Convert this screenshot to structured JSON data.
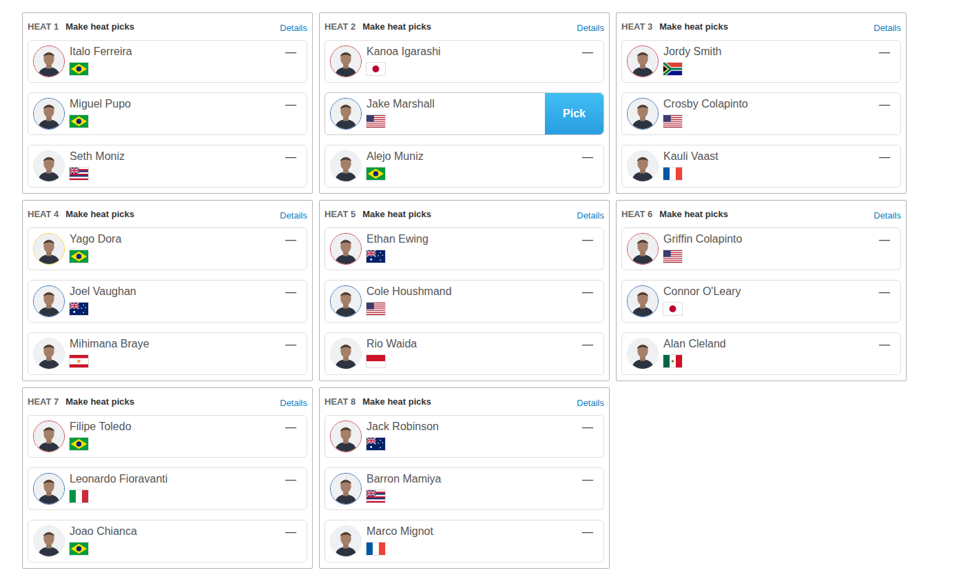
{
  "pick_label": "Pick",
  "heats": [
    {
      "label": "HEAT 1",
      "action": "Make heat picks",
      "details": "Details",
      "athletes": [
        {
          "name": "Italo Ferreira",
          "kind": "BRA",
          "color": "#d0454c",
          "hovered": false,
          "result": "—"
        },
        {
          "name": "Miguel Pupo",
          "kind": "BRA",
          "color": "#3a6fb5",
          "hovered": false,
          "result": "—"
        },
        {
          "name": "Seth Moniz",
          "kind": "HAW",
          "color": "#e8e8e8",
          "hovered": false,
          "result": "—"
        }
      ]
    },
    {
      "label": "HEAT 2",
      "action": "Make heat picks",
      "details": "Details",
      "athletes": [
        {
          "name": "Kanoa Igarashi",
          "kind": "JPN",
          "color": "#d0454c",
          "hovered": false,
          "result": "—"
        },
        {
          "name": "Jake Marshall",
          "kind": "USA",
          "color": "#3a6fb5",
          "hovered": true
        },
        {
          "name": "Alejo Muniz",
          "kind": "BRA",
          "color": "#e8e8e8",
          "hovered": false,
          "result": "—"
        }
      ]
    },
    {
      "label": "HEAT 3",
      "action": "Make heat picks",
      "details": "Details",
      "athletes": [
        {
          "name": "Jordy Smith",
          "kind": "RSA",
          "color": "#d0454c",
          "hovered": false,
          "result": "—"
        },
        {
          "name": "Crosby Colapinto",
          "kind": "USA",
          "color": "#3a6fb5",
          "hovered": false,
          "result": "—"
        },
        {
          "name": "Kauli Vaast",
          "kind": "FRA",
          "color": "#e8e8e8",
          "hovered": false,
          "result": "—"
        }
      ]
    },
    {
      "label": "HEAT 4",
      "action": "Make heat picks",
      "details": "Details",
      "athletes": [
        {
          "name": "Yago Dora",
          "kind": "BRA",
          "color": "#f2d13b",
          "hovered": false,
          "result": "—"
        },
        {
          "name": "Joel Vaughan",
          "kind": "AUS",
          "color": "#3a6fb5",
          "hovered": false,
          "result": "—"
        },
        {
          "name": "Mihimana Braye",
          "kind": "PYF",
          "color": "#e8e8e8",
          "hovered": false,
          "result": "—"
        }
      ]
    },
    {
      "label": "HEAT 5",
      "action": "Make heat picks",
      "details": "Details",
      "athletes": [
        {
          "name": "Ethan Ewing",
          "kind": "AUS",
          "color": "#d0454c",
          "hovered": false,
          "result": "—"
        },
        {
          "name": "Cole Houshmand",
          "kind": "USA",
          "color": "#3a6fb5",
          "hovered": false,
          "result": "—"
        },
        {
          "name": "Rio Waida",
          "kind": "IDN",
          "color": "#e8e8e8",
          "hovered": false,
          "result": "—"
        }
      ]
    },
    {
      "label": "HEAT 6",
      "action": "Make heat picks",
      "details": "Details",
      "athletes": [
        {
          "name": "Griffin Colapinto",
          "kind": "USA",
          "color": "#d0454c",
          "hovered": false,
          "result": "—"
        },
        {
          "name": "Connor O'Leary",
          "kind": "JPN",
          "color": "#3a6fb5",
          "hovered": false,
          "result": "—"
        },
        {
          "name": "Alan Cleland",
          "kind": "MEX",
          "color": "#e8e8e8",
          "hovered": false,
          "result": "—"
        }
      ]
    },
    {
      "label": "HEAT 7",
      "action": "Make heat picks",
      "details": "Details",
      "athletes": [
        {
          "name": "Filipe Toledo",
          "kind": "BRA",
          "color": "#d0454c",
          "hovered": false,
          "result": "—"
        },
        {
          "name": "Leonardo Fioravanti",
          "kind": "ITA",
          "color": "#3a6fb5",
          "hovered": false,
          "result": "—"
        },
        {
          "name": "Joao Chianca",
          "kind": "BRA",
          "color": "#e8e8e8",
          "hovered": false,
          "result": "—"
        }
      ]
    },
    {
      "label": "HEAT 8",
      "action": "Make heat picks",
      "details": "Details",
      "athletes": [
        {
          "name": "Jack Robinson",
          "kind": "AUS",
          "color": "#d0454c",
          "hovered": false,
          "result": "—"
        },
        {
          "name": "Barron Mamiya",
          "kind": "HAW",
          "color": "#3a6fb5",
          "hovered": false,
          "result": "—"
        },
        {
          "name": "Marco Mignot",
          "kind": "FRA",
          "color": "#e8e8e8",
          "hovered": false,
          "result": "—"
        }
      ]
    }
  ]
}
